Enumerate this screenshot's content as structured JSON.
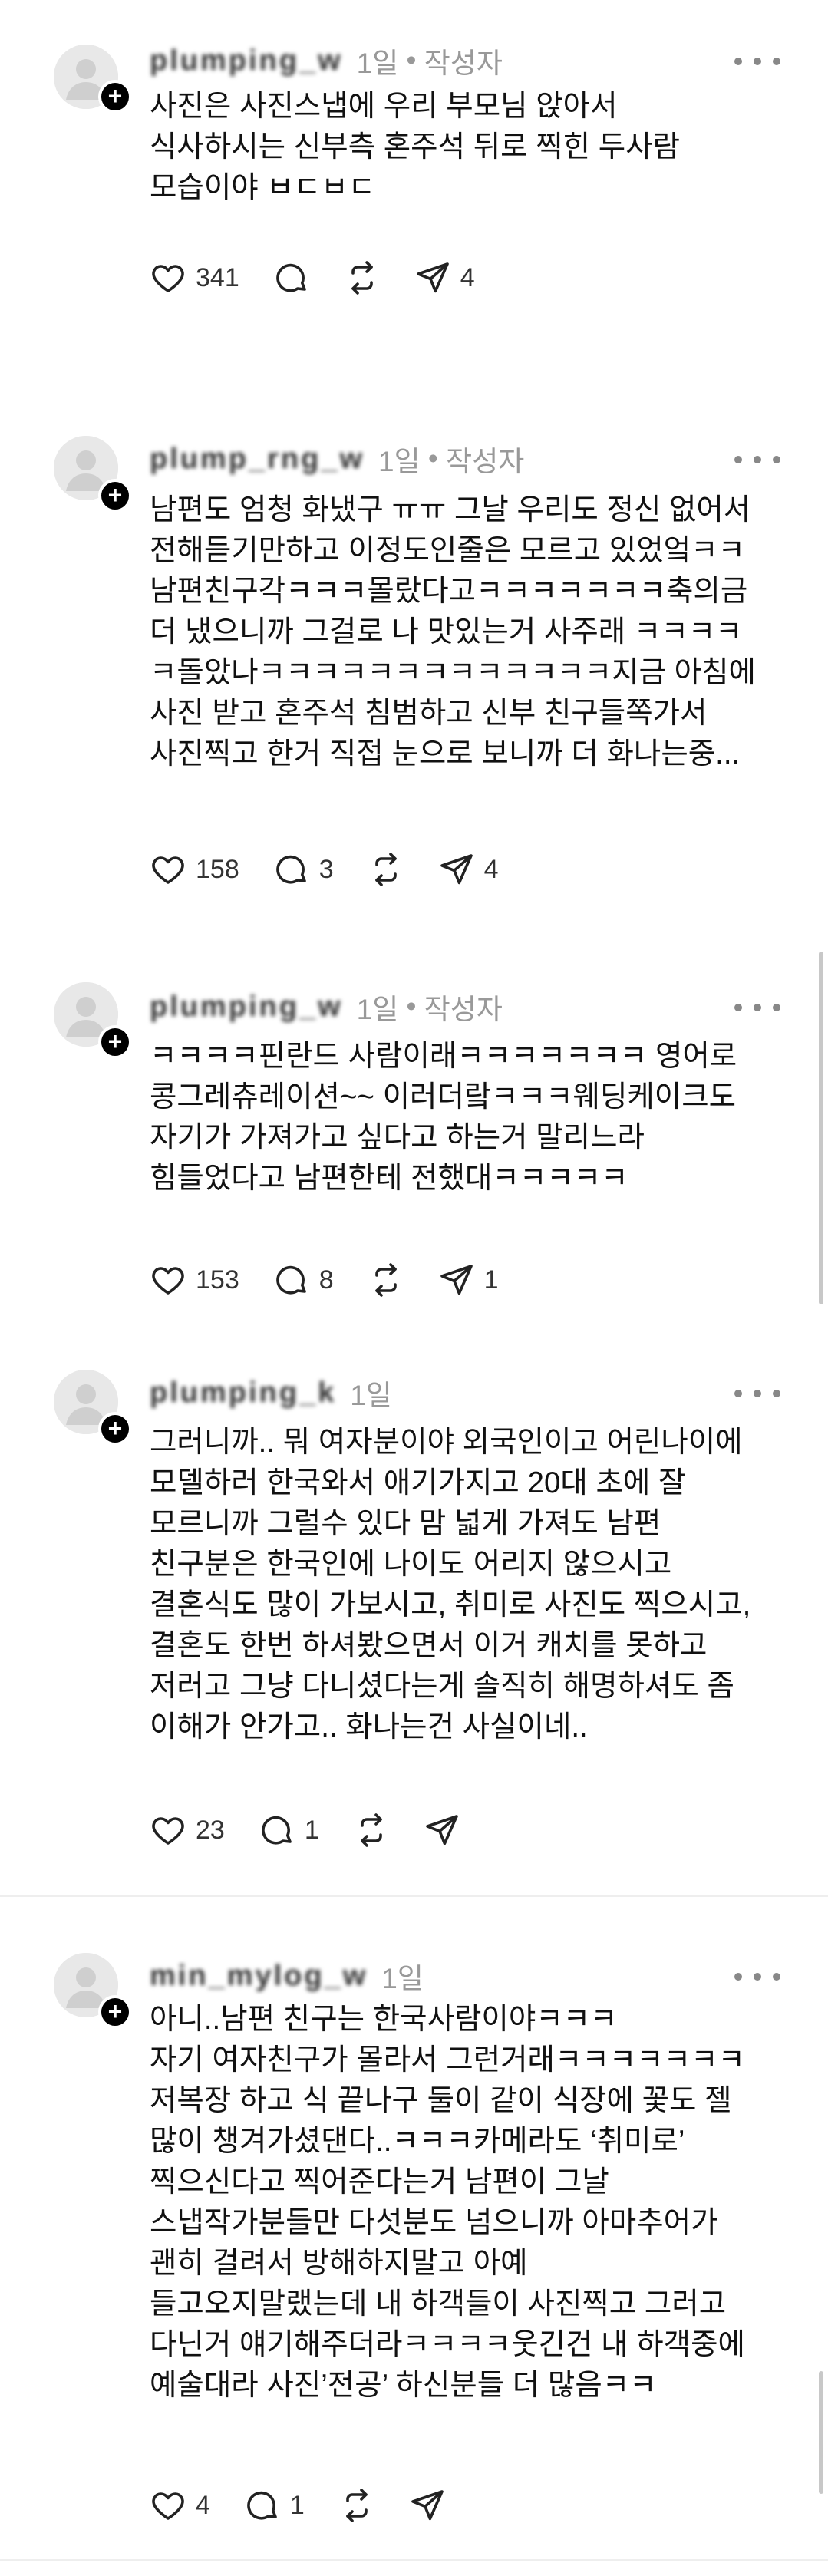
{
  "comments": [
    {
      "username": "plumping_w",
      "time": "1일",
      "author_tag": "작성자",
      "text": "사진은 사진스냅에 우리 부모님 앉아서\n식사하시는 신부측 혼주석 뒤로 찍힌 두사람\n모습이야 ㅂㄷㅂㄷ",
      "likes": "341",
      "replies": "",
      "reposts": "",
      "shares": "4"
    },
    {
      "username": "plump_rng_w",
      "time": "1일",
      "author_tag": "작성자",
      "text": "남편도 엄청 화냈구 ㅠㅠ 그날 우리도 정신 없어서\n전해듣기만하고 이정도인줄은 모르고 있었엌ㅋㅋ\n남편친구각ㅋㅋㅋ몰랐다고ㅋㅋㅋㅋㅋㅋㅋ축의금\n더 냈으니까 그걸로 나 맛있는거 사주래 ㅋㅋㅋㅋ\nㅋ돌았나ㅋㅋㅋㅋㅋㅋㅋㅋㅋㅋㅋㅋㅋ지금 아침에\n사진 받고 혼주석 침범하고 신부 친구들쪽가서\n사진찍고 한거 직접 눈으로 보니까 더 화나는중...",
      "likes": "158",
      "replies": "3",
      "reposts": "",
      "shares": "4"
    },
    {
      "username": "plumping_w",
      "time": "1일",
      "author_tag": "작성자",
      "text": "ㅋㅋㅋㅋ핀란드 사람이래ㅋㅋㅋㅋㅋㅋㅋ 영어로\n콩그레츄레이션~~ 이러더랔ㅋㅋㅋ웨딩케이크도\n자기가 가져가고 싶다고 하는거 말리느라\n힘들었다고 남편한테 전했대ㅋㅋㅋㅋㅋ",
      "likes": "153",
      "replies": "8",
      "reposts": "",
      "shares": "1"
    },
    {
      "username": "plumping_k",
      "time": "1일",
      "author_tag": "",
      "text": "그러니까.. 뭐 여자분이야 외국인이고 어린나이에\n모델하러 한국와서 애기가지고 20대 초에 잘\n모르니까 그럴수 있다 맘 넓게 가져도 남편\n친구분은 한국인에 나이도 어리지 않으시고\n결혼식도 많이 가보시고, 취미로 사진도 찍으시고,\n결혼도 한번 하셔봤으면서 이거 캐치를 못하고\n저러고 그냥 다니셨다는게 솔직히 해명하셔도 좀\n이해가 안가고.. 화나는건 사실이네..",
      "likes": "23",
      "replies": "1",
      "reposts": "",
      "shares": ""
    },
    {
      "username": "min_mylog_w",
      "time": "1일",
      "author_tag": "",
      "text": "아니..남편 친구는 한국사람이야ㅋㅋㅋ\n자기 여자친구가 몰라서 그런거래ㅋㅋㅋㅋㅋㅋㅋ\n저복장 하고 식 끝나구 둘이 같이 식장에 꽃도 젤\n많이 챙겨가셨댄다..ㅋㅋㅋ카메라도 ‘취미로’\n찍으신다고 찍어준다는거 남편이 그날\n스냅작가분들만 다섯분도 넘으니까 아마추어가\n괜히 걸려서 방해하지말고 아예\n들고오지말랬는데 내 하객들이 사진찍고 그러고\n다닌거 얘기해주더라ㅋㅋㅋㅋ웃긴건 내 하객중에\n예술대라 사진’전공’ 하신분들 더 많음ㅋㅋ",
      "likes": "4",
      "replies": "1",
      "reposts": "",
      "shares": ""
    }
  ]
}
